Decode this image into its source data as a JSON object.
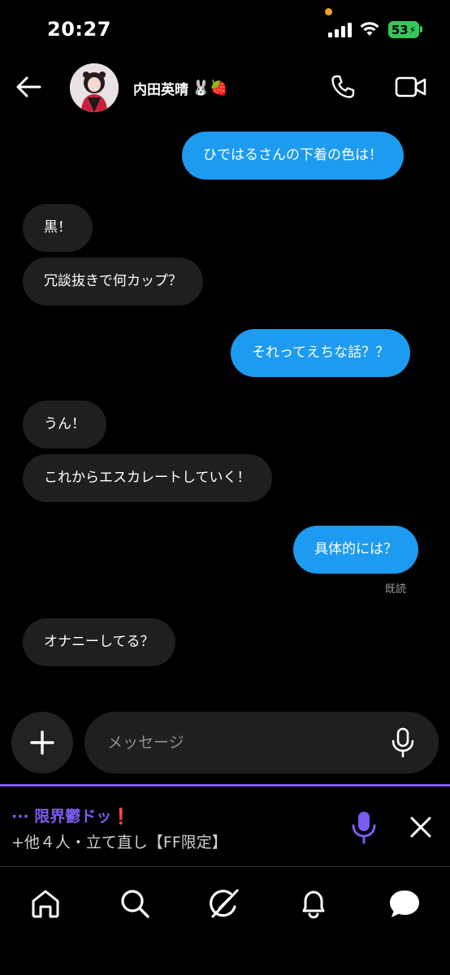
{
  "status_bar": {
    "time": "20:27",
    "battery_percent": "53"
  },
  "header": {
    "contact_name": "内田英晴",
    "name_emojis": "🐰🍓"
  },
  "messages": [
    {
      "direction": "outgoing",
      "text": "ひではるさんの下着の色は！"
    },
    {
      "direction": "incoming",
      "text": "黒！"
    },
    {
      "direction": "incoming",
      "text": "冗談抜きで何カップ？"
    },
    {
      "direction": "outgoing",
      "text": "それってえちな話？？"
    },
    {
      "direction": "incoming",
      "text": "うん！"
    },
    {
      "direction": "incoming",
      "text": "これからエスカレートしていく！"
    },
    {
      "direction": "outgoing",
      "text": "具体的には？"
    },
    {
      "direction": "incoming",
      "text": "オナニーしてる？"
    }
  ],
  "read_receipt": "既読",
  "composer": {
    "placeholder": "メッセージ"
  },
  "space": {
    "title": "··· 限界鬱ドッ❗",
    "subtitle": "+他４人・立て直し【FF限定】"
  },
  "colors": {
    "outgoing_bubble": "#1d9bf0",
    "incoming_bubble": "#1f1f1f",
    "space_accent": "#7c5cf0",
    "background": "#000000"
  }
}
